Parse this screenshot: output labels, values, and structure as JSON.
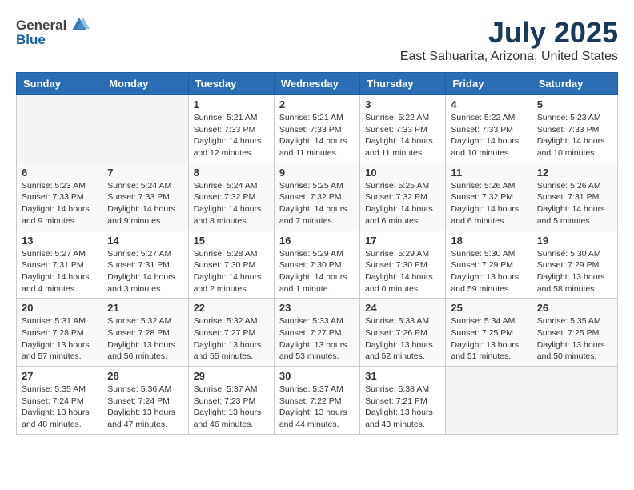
{
  "header": {
    "logo_general": "General",
    "logo_blue": "Blue",
    "month": "July 2025",
    "location": "East Sahuarita, Arizona, United States"
  },
  "weekdays": [
    "Sunday",
    "Monday",
    "Tuesday",
    "Wednesday",
    "Thursday",
    "Friday",
    "Saturday"
  ],
  "weeks": [
    [
      {
        "day": "",
        "info": ""
      },
      {
        "day": "",
        "info": ""
      },
      {
        "day": "1",
        "info": "Sunrise: 5:21 AM\nSunset: 7:33 PM\nDaylight: 14 hours\nand 12 minutes."
      },
      {
        "day": "2",
        "info": "Sunrise: 5:21 AM\nSunset: 7:33 PM\nDaylight: 14 hours\nand 11 minutes."
      },
      {
        "day": "3",
        "info": "Sunrise: 5:22 AM\nSunset: 7:33 PM\nDaylight: 14 hours\nand 11 minutes."
      },
      {
        "day": "4",
        "info": "Sunrise: 5:22 AM\nSunset: 7:33 PM\nDaylight: 14 hours\nand 10 minutes."
      },
      {
        "day": "5",
        "info": "Sunrise: 5:23 AM\nSunset: 7:33 PM\nDaylight: 14 hours\nand 10 minutes."
      }
    ],
    [
      {
        "day": "6",
        "info": "Sunrise: 5:23 AM\nSunset: 7:33 PM\nDaylight: 14 hours\nand 9 minutes."
      },
      {
        "day": "7",
        "info": "Sunrise: 5:24 AM\nSunset: 7:33 PM\nDaylight: 14 hours\nand 9 minutes."
      },
      {
        "day": "8",
        "info": "Sunrise: 5:24 AM\nSunset: 7:32 PM\nDaylight: 14 hours\nand 8 minutes."
      },
      {
        "day": "9",
        "info": "Sunrise: 5:25 AM\nSunset: 7:32 PM\nDaylight: 14 hours\nand 7 minutes."
      },
      {
        "day": "10",
        "info": "Sunrise: 5:25 AM\nSunset: 7:32 PM\nDaylight: 14 hours\nand 6 minutes."
      },
      {
        "day": "11",
        "info": "Sunrise: 5:26 AM\nSunset: 7:32 PM\nDaylight: 14 hours\nand 6 minutes."
      },
      {
        "day": "12",
        "info": "Sunrise: 5:26 AM\nSunset: 7:31 PM\nDaylight: 14 hours\nand 5 minutes."
      }
    ],
    [
      {
        "day": "13",
        "info": "Sunrise: 5:27 AM\nSunset: 7:31 PM\nDaylight: 14 hours\nand 4 minutes."
      },
      {
        "day": "14",
        "info": "Sunrise: 5:27 AM\nSunset: 7:31 PM\nDaylight: 14 hours\nand 3 minutes."
      },
      {
        "day": "15",
        "info": "Sunrise: 5:28 AM\nSunset: 7:30 PM\nDaylight: 14 hours\nand 2 minutes."
      },
      {
        "day": "16",
        "info": "Sunrise: 5:29 AM\nSunset: 7:30 PM\nDaylight: 14 hours\nand 1 minute."
      },
      {
        "day": "17",
        "info": "Sunrise: 5:29 AM\nSunset: 7:30 PM\nDaylight: 14 hours\nand 0 minutes."
      },
      {
        "day": "18",
        "info": "Sunrise: 5:30 AM\nSunset: 7:29 PM\nDaylight: 13 hours\nand 59 minutes."
      },
      {
        "day": "19",
        "info": "Sunrise: 5:30 AM\nSunset: 7:29 PM\nDaylight: 13 hours\nand 58 minutes."
      }
    ],
    [
      {
        "day": "20",
        "info": "Sunrise: 5:31 AM\nSunset: 7:28 PM\nDaylight: 13 hours\nand 57 minutes."
      },
      {
        "day": "21",
        "info": "Sunrise: 5:32 AM\nSunset: 7:28 PM\nDaylight: 13 hours\nand 56 minutes."
      },
      {
        "day": "22",
        "info": "Sunrise: 5:32 AM\nSunset: 7:27 PM\nDaylight: 13 hours\nand 55 minutes."
      },
      {
        "day": "23",
        "info": "Sunrise: 5:33 AM\nSunset: 7:27 PM\nDaylight: 13 hours\nand 53 minutes."
      },
      {
        "day": "24",
        "info": "Sunrise: 5:33 AM\nSunset: 7:26 PM\nDaylight: 13 hours\nand 52 minutes."
      },
      {
        "day": "25",
        "info": "Sunrise: 5:34 AM\nSunset: 7:25 PM\nDaylight: 13 hours\nand 51 minutes."
      },
      {
        "day": "26",
        "info": "Sunrise: 5:35 AM\nSunset: 7:25 PM\nDaylight: 13 hours\nand 50 minutes."
      }
    ],
    [
      {
        "day": "27",
        "info": "Sunrise: 5:35 AM\nSunset: 7:24 PM\nDaylight: 13 hours\nand 48 minutes."
      },
      {
        "day": "28",
        "info": "Sunrise: 5:36 AM\nSunset: 7:24 PM\nDaylight: 13 hours\nand 47 minutes."
      },
      {
        "day": "29",
        "info": "Sunrise: 5:37 AM\nSunset: 7:23 PM\nDaylight: 13 hours\nand 46 minutes."
      },
      {
        "day": "30",
        "info": "Sunrise: 5:37 AM\nSunset: 7:22 PM\nDaylight: 13 hours\nand 44 minutes."
      },
      {
        "day": "31",
        "info": "Sunrise: 5:38 AM\nSunset: 7:21 PM\nDaylight: 13 hours\nand 43 minutes."
      },
      {
        "day": "",
        "info": ""
      },
      {
        "day": "",
        "info": ""
      }
    ]
  ]
}
